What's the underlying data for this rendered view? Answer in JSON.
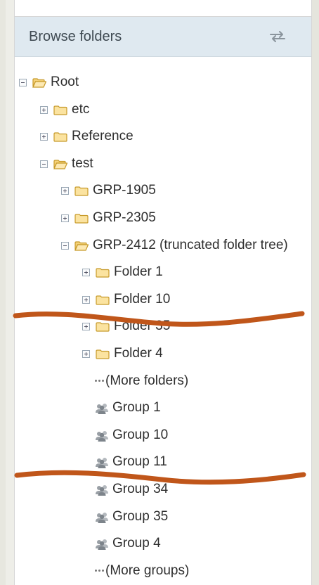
{
  "panel": {
    "title": "Browse folders",
    "toggle_icon": "swap-arrows-icon"
  },
  "tree": [
    {
      "label": "Root",
      "depth": 0,
      "kind": "folder",
      "expanded": true
    },
    {
      "label": "etc",
      "depth": 1,
      "kind": "folder",
      "expanded": false
    },
    {
      "label": "Reference",
      "depth": 1,
      "kind": "folder",
      "expanded": false
    },
    {
      "label": "test",
      "depth": 1,
      "kind": "folder",
      "expanded": true
    },
    {
      "label": "GRP-1905",
      "depth": 2,
      "kind": "folder",
      "expanded": false
    },
    {
      "label": "GRP-2305",
      "depth": 2,
      "kind": "folder",
      "expanded": false
    },
    {
      "label": "GRP-2412 (truncated folder tree)",
      "depth": 2,
      "kind": "folder",
      "expanded": true
    },
    {
      "label": "Folder 1",
      "depth": 3,
      "kind": "folder",
      "expanded": false
    },
    {
      "label": "Folder 10",
      "depth": 3,
      "kind": "folder",
      "expanded": false
    },
    {
      "label": "Folder 35",
      "depth": 3,
      "kind": "folder",
      "expanded": false
    },
    {
      "label": "Folder 4",
      "depth": 3,
      "kind": "folder",
      "expanded": false
    },
    {
      "label": "(More folders)",
      "depth": 3,
      "kind": "more"
    },
    {
      "label": "Group 1",
      "depth": 3,
      "kind": "group"
    },
    {
      "label": "Group 10",
      "depth": 3,
      "kind": "group"
    },
    {
      "label": "Group 11",
      "depth": 3,
      "kind": "group"
    },
    {
      "label": "Group 34",
      "depth": 3,
      "kind": "group"
    },
    {
      "label": "Group 35",
      "depth": 3,
      "kind": "group"
    },
    {
      "label": "Group 4",
      "depth": 3,
      "kind": "group"
    },
    {
      "label": "(More groups)",
      "depth": 3,
      "kind": "more"
    }
  ],
  "colors": {
    "header_bg": "#dfe9f0",
    "folder_fill": "#fbe3a0",
    "folder_stroke": "#c79a2a",
    "scribble": "#c0561a"
  }
}
